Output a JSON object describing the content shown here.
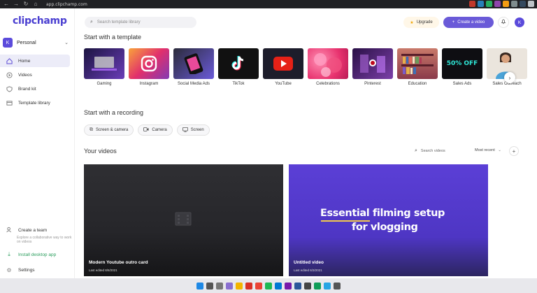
{
  "browser": {
    "url": "app.clipchamp.com"
  },
  "app": {
    "logo": "clipchamp"
  },
  "workspace": {
    "initial": "K",
    "name": "Personal"
  },
  "sidebar": {
    "items": [
      {
        "label": "Home",
        "icon": "home-icon"
      },
      {
        "label": "Videos",
        "icon": "play-circle-icon"
      },
      {
        "label": "Brand kit",
        "icon": "shield-icon"
      },
      {
        "label": "Template library",
        "icon": "template-icon"
      }
    ],
    "team_title": "Create a team",
    "team_desc": "Explore a collaborative way to work on videos",
    "install": "Install desktop app",
    "settings": "Settings"
  },
  "topbar": {
    "search_placeholder": "Search template library",
    "upgrade": "Upgrade",
    "create": "Create a video",
    "avatar": "K"
  },
  "templates": {
    "heading": "Start with a template",
    "items": [
      {
        "label": "Gaming",
        "color": "#3a2a6a"
      },
      {
        "label": "Instagram",
        "color": "#e84a6f"
      },
      {
        "label": "Social Media Ads",
        "color": "#2b2b3a"
      },
      {
        "label": "TikTok",
        "color": "#111111"
      },
      {
        "label": "YouTube",
        "color": "#1d1d2b"
      },
      {
        "label": "Celebrations",
        "color": "#f05a8a"
      },
      {
        "label": "Pinterest",
        "color": "#4a1f6e"
      },
      {
        "label": "Education",
        "color": "#b45a6a"
      },
      {
        "label": "Sales Ads",
        "color": "#0e0e12"
      },
      {
        "label": "Sales Outreach",
        "color": "#e8e2da"
      }
    ],
    "sales_ads_text": "50% OFF"
  },
  "recording": {
    "heading": "Start with a recording",
    "buttons": [
      "Screen & camera",
      "Camera",
      "Screen"
    ]
  },
  "videos": {
    "heading": "Your videos",
    "search": "Search videos",
    "sort": "Most recent",
    "cards": [
      {
        "title": "Modern Youtube outro card",
        "date": "Last edited 8/6/2021",
        "bg": "#2a2a2e"
      },
      {
        "title": "Untitled video",
        "date": "Last edited 6/3/2021",
        "bg": "#5b3fd6",
        "overlay_line1": "Essential filming setup",
        "overlay_line2": "for vlogging"
      }
    ]
  }
}
